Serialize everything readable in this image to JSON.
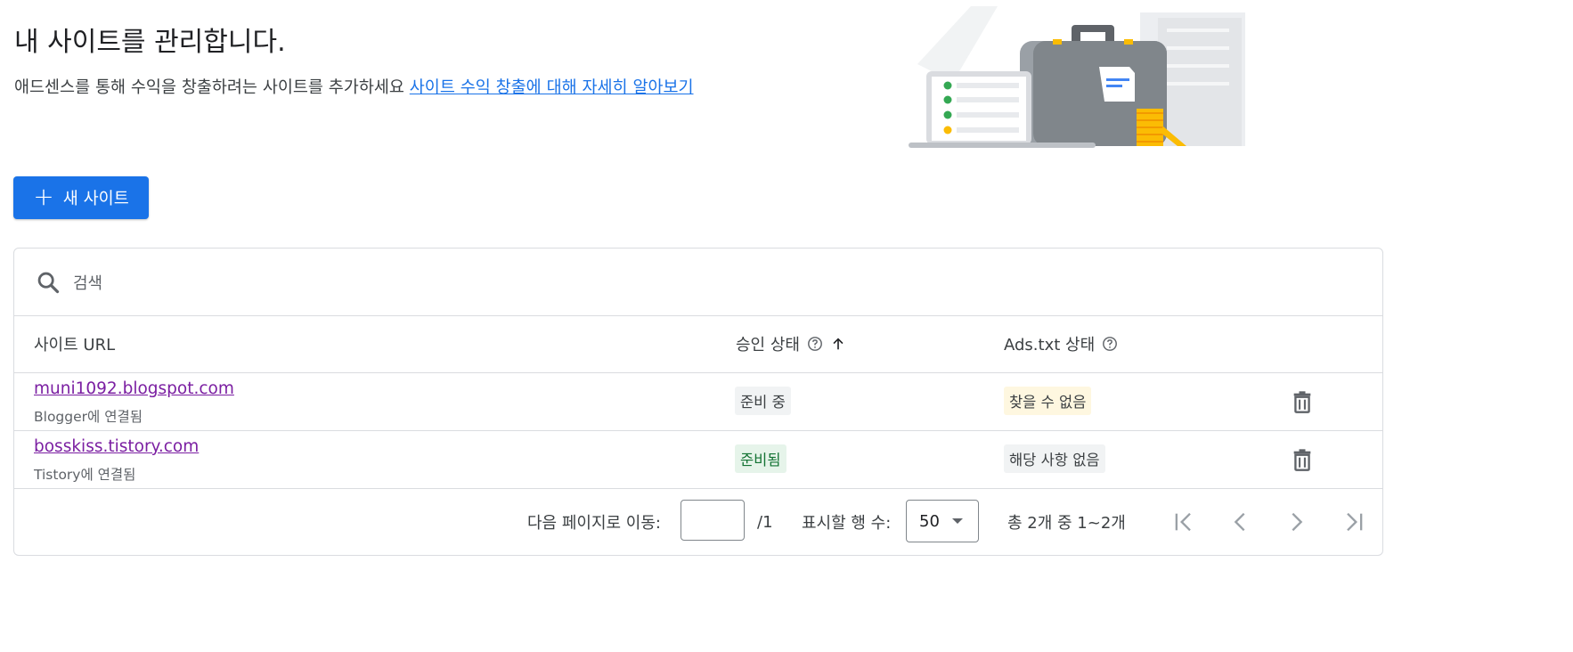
{
  "header": {
    "title": "내 사이트를 관리합니다.",
    "subtitle": "애드센스를 통해 수익을 창출하려는 사이트를 추가하세요",
    "learn_more_link": "사이트 수익 창출에 대해 자세히 알아보기"
  },
  "toolbar": {
    "new_site_label": "새 사이트"
  },
  "search": {
    "placeholder": "검색"
  },
  "table": {
    "columns": {
      "site_url": "사이트 URL",
      "approval_status": "승인 상태",
      "ads_txt_status": "Ads.txt 상태"
    },
    "rows": [
      {
        "url": "muni1092.blogspot.com",
        "connected": "Blogger에 연결됨",
        "approval": "준비 중",
        "ads_txt": "찾을 수 없음"
      },
      {
        "url": "bosskiss.tistory.com",
        "connected": "Tistory에 연결됨",
        "approval": "준비됨",
        "ads_txt": "해당 사항 없음"
      }
    ]
  },
  "pagination": {
    "goto_label": "다음 페이지로 이동:",
    "page_total": "/1",
    "rows_label": "표시할 행 수:",
    "rows_value": "50",
    "range_text": "총 2개 중 1~2개"
  },
  "colors": {
    "primary": "#1a73e8",
    "visited_link": "#7b1fa2",
    "ready_bg": "#e6f4ea",
    "ready_text": "#137333",
    "warning_bg": "#fef7e0",
    "neutral_chip": "#f1f3f4"
  }
}
